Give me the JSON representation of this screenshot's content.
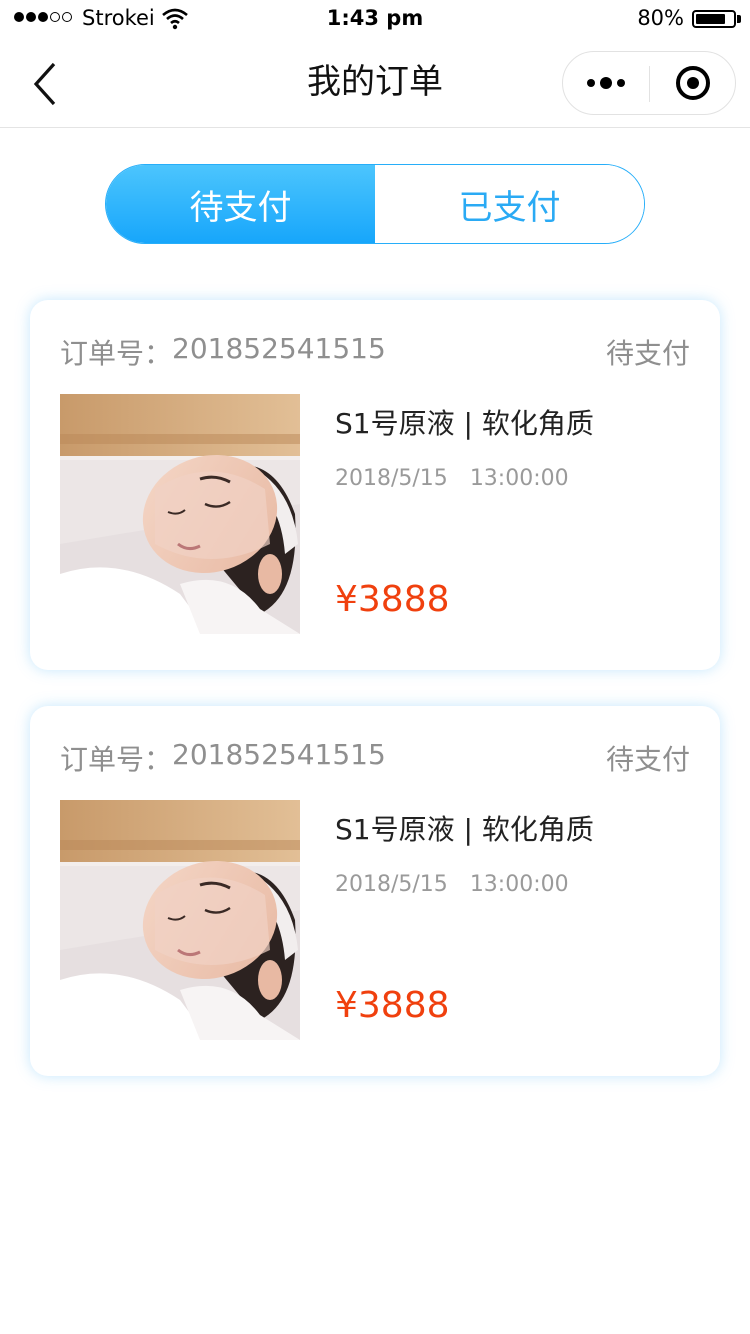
{
  "status_bar": {
    "carrier": "Strokei",
    "time": "1:43 pm",
    "battery_pct": "80%",
    "battery_level": 0.8,
    "signal_strength": 3,
    "signal_max": 5
  },
  "nav": {
    "title": "我的订单",
    "back_icon": "chevron-left-icon",
    "more_icon": "more-dots-icon",
    "close_icon": "target-ring-icon"
  },
  "tabs": [
    {
      "label": "待支付",
      "active": true
    },
    {
      "label": "已支付",
      "active": false
    }
  ],
  "orders": [
    {
      "order_no_label": "订单号：",
      "order_no": "201852541515",
      "status": "待支付",
      "product_name": "S1号原液 | 软化角质",
      "date": "2018/5/15",
      "time": "13:00:00",
      "price": "¥3888"
    },
    {
      "order_no_label": "订单号：",
      "order_no": "201852541515",
      "status": "待支付",
      "product_name": "S1号原液 | 软化角质",
      "date": "2018/5/15",
      "time": "13:00:00",
      "price": "¥3888"
    }
  ],
  "colors": {
    "accent": "#1fa9fb",
    "price": "#f0400e",
    "muted_text": "#8f8f8f"
  }
}
